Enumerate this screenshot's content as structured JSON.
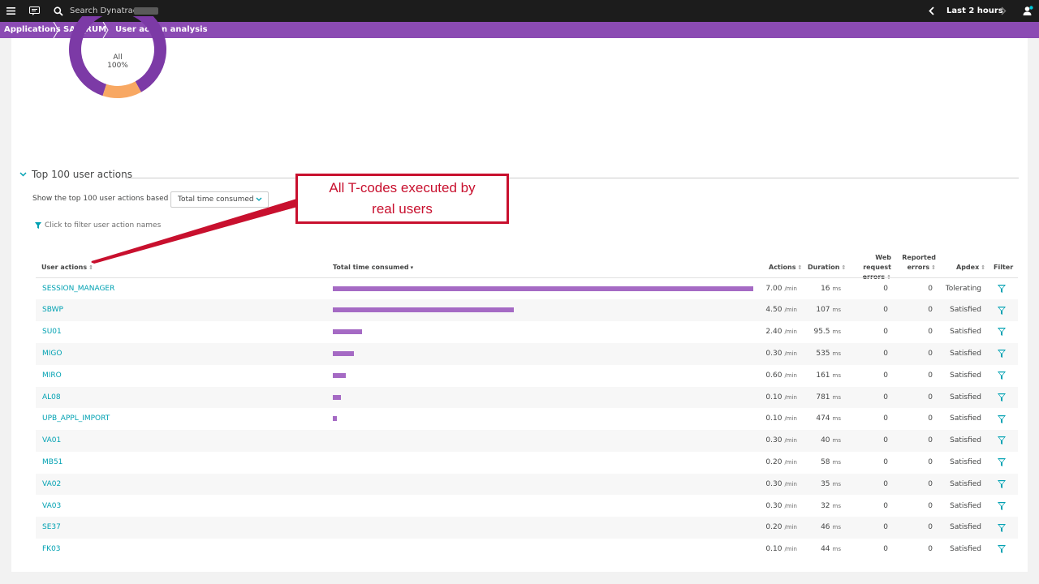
{
  "topbar": {
    "search_placeholder": "Search Dynatrace",
    "timeframe": "Last 2 hours"
  },
  "breadcrumb": {
    "items": [
      "Applications",
      "SAP_RUM",
      "User action analysis"
    ]
  },
  "donut": {
    "label": "All",
    "percent": "100%",
    "segments": [
      {
        "color": "#7c3aa6",
        "fraction": 0.87
      },
      {
        "color": "#f8a863",
        "fraction": 0.13
      }
    ]
  },
  "section": {
    "title": "Top 100 user actions",
    "basis_label": "Show the top 100 user actions based on",
    "basis_value": "Total time consumed",
    "filter_link": "Click to filter user action names"
  },
  "annotation": {
    "line1": "All T-codes executed by",
    "line2": "real users"
  },
  "table": {
    "headers": {
      "name": "User actions",
      "total": "Total time consumed",
      "actions": "Actions",
      "duration": "Duration",
      "web_errors_1": "Web request",
      "web_errors_2": "errors",
      "reported_1": "Reported",
      "reported_2": "errors",
      "apdex": "Apdex",
      "filter": "Filter"
    },
    "rows": [
      {
        "name": "SESSION_MANAGER",
        "share": 1.0,
        "actions": "7.00",
        "actions_unit": "/min",
        "duration": "16",
        "duration_unit": "ms",
        "web_errors": "0",
        "reported": "0",
        "apdex": "Tolerating"
      },
      {
        "name": "SBWP",
        "share": 0.43,
        "actions": "4.50",
        "actions_unit": "/min",
        "duration": "107",
        "duration_unit": "ms",
        "web_errors": "0",
        "reported": "0",
        "apdex": "Satisfied"
      },
      {
        "name": "SU01",
        "share": 0.07,
        "actions": "2.40",
        "actions_unit": "/min",
        "duration": "95.5",
        "duration_unit": "ms",
        "web_errors": "0",
        "reported": "0",
        "apdex": "Satisfied"
      },
      {
        "name": "MIGO",
        "share": 0.05,
        "actions": "0.30",
        "actions_unit": "/min",
        "duration": "535",
        "duration_unit": "ms",
        "web_errors": "0",
        "reported": "0",
        "apdex": "Satisfied"
      },
      {
        "name": "MIRO",
        "share": 0.03,
        "actions": "0.60",
        "actions_unit": "/min",
        "duration": "161",
        "duration_unit": "ms",
        "web_errors": "0",
        "reported": "0",
        "apdex": "Satisfied"
      },
      {
        "name": "AL08",
        "share": 0.02,
        "actions": "0.10",
        "actions_unit": "/min",
        "duration": "781",
        "duration_unit": "ms",
        "web_errors": "0",
        "reported": "0",
        "apdex": "Satisfied"
      },
      {
        "name": "UPB_APPL_IMPORT",
        "share": 0.01,
        "actions": "0.10",
        "actions_unit": "/min",
        "duration": "474",
        "duration_unit": "ms",
        "web_errors": "0",
        "reported": "0",
        "apdex": "Satisfied"
      },
      {
        "name": "VA01",
        "share": 0,
        "actions": "0.30",
        "actions_unit": "/min",
        "duration": "40",
        "duration_unit": "ms",
        "web_errors": "0",
        "reported": "0",
        "apdex": "Satisfied"
      },
      {
        "name": "MB51",
        "share": 0,
        "actions": "0.20",
        "actions_unit": "/min",
        "duration": "58",
        "duration_unit": "ms",
        "web_errors": "0",
        "reported": "0",
        "apdex": "Satisfied"
      },
      {
        "name": "VA02",
        "share": 0,
        "actions": "0.30",
        "actions_unit": "/min",
        "duration": "35",
        "duration_unit": "ms",
        "web_errors": "0",
        "reported": "0",
        "apdex": "Satisfied"
      },
      {
        "name": "VA03",
        "share": 0,
        "actions": "0.30",
        "actions_unit": "/min",
        "duration": "32",
        "duration_unit": "ms",
        "web_errors": "0",
        "reported": "0",
        "apdex": "Satisfied"
      },
      {
        "name": "SE37",
        "share": 0,
        "actions": "0.20",
        "actions_unit": "/min",
        "duration": "46",
        "duration_unit": "ms",
        "web_errors": "0",
        "reported": "0",
        "apdex": "Satisfied"
      },
      {
        "name": "FK03",
        "share": 0,
        "actions": "0.10",
        "actions_unit": "/min",
        "duration": "44",
        "duration_unit": "ms",
        "web_errors": "0",
        "reported": "0",
        "apdex": "Satisfied"
      }
    ]
  },
  "colors": {
    "accent": "#00a1b2",
    "brand_purple": "#8b4bb3",
    "bar": "#a56ac4",
    "annotation": "#c8102e"
  },
  "icons": [
    "menu-icon",
    "feedback-icon",
    "search-icon",
    "chevron-left-icon",
    "chevron-right-icon",
    "user-icon",
    "chevron-down-icon",
    "filter-icon"
  ]
}
